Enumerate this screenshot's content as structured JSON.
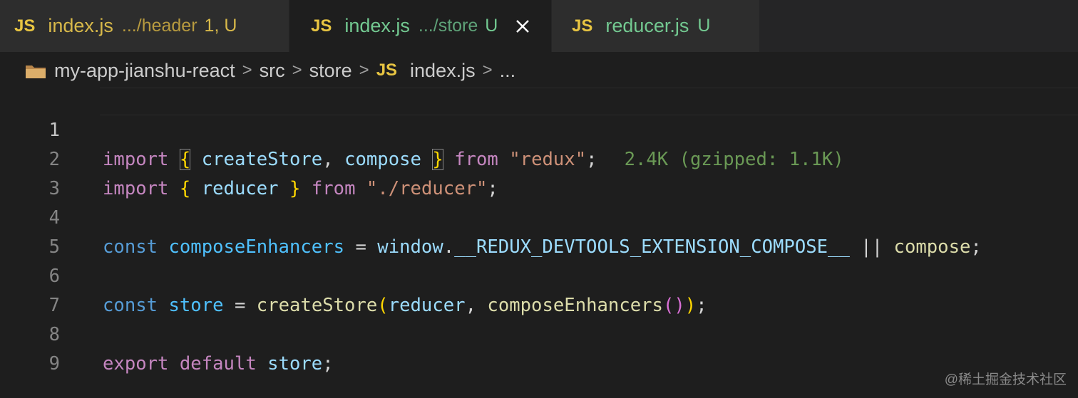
{
  "tabs": [
    {
      "icon": "JS",
      "name": "index.js",
      "dir": ".../header",
      "status": "1, U",
      "color": "#d8b94a",
      "active": false
    },
    {
      "icon": "JS",
      "name": "index.js",
      "dir": ".../store",
      "status": "U",
      "color": "#73c991",
      "active": true
    },
    {
      "icon": "JS",
      "name": "reducer.js",
      "dir": "",
      "status": "U",
      "color": "#73c991",
      "active": false
    }
  ],
  "breadcrumb": {
    "project": "my-app-jianshu-react",
    "sep": ">",
    "items": [
      "src",
      "store"
    ],
    "file_icon": "JS",
    "file": "index.js",
    "more": "..."
  },
  "editor": {
    "line_numbers": [
      "1",
      "2",
      "3",
      "4",
      "5",
      "6",
      "7",
      "8",
      "9"
    ],
    "line1": {
      "kw": "import",
      "open": "{",
      "a": "createStore",
      "comma": ",",
      "b": "compose",
      "close": "}",
      "from": "from",
      "str": "\"redux\"",
      "semi": ";",
      "hint": "2.4K (gzipped: 1.1K)"
    },
    "line2": {
      "kw": "import",
      "open": "{",
      "a": "reducer",
      "close": "}",
      "from": "from",
      "str": "\"./reducer\"",
      "semi": ";"
    },
    "line4": {
      "kw": "const",
      "name": "composeEnhancers",
      "eq": "=",
      "obj": "window",
      "dot": ".",
      "prop": "__REDUX_DEVTOOLS_EXTENSION_COMPOSE__",
      "or": "||",
      "fn": "compose",
      "semi": ";"
    },
    "line6": {
      "kw": "const",
      "name": "store",
      "eq": "=",
      "fn": "createStore",
      "open": "(",
      "arg1": "reducer",
      "comma": ",",
      "fn2": "composeEnhancers",
      "inner": "()",
      "close": ")",
      "semi": ";"
    },
    "line8": {
      "kw1": "export",
      "kw2": "default",
      "name": "store",
      "semi": ";"
    }
  },
  "watermark": "@稀土掘金技术社区",
  "colors": {
    "editor_bg": "#1e1e1e",
    "tab_bar_bg": "#252526",
    "js_icon": "#e8c542"
  }
}
